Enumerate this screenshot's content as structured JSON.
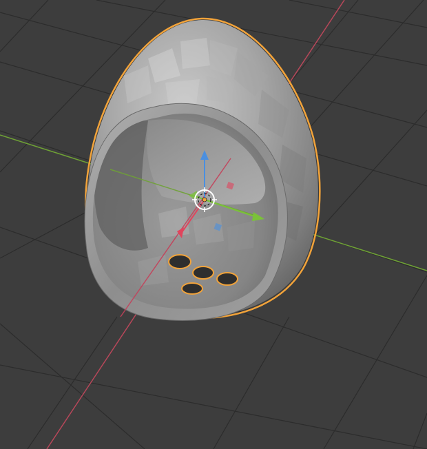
{
  "viewport": {
    "mode": "object",
    "background_color": "#3d3d3d",
    "grid_color": "#2b2b2b",
    "x_axis_color": "#d94b5c",
    "y_axis_color": "#7bb83a",
    "z_axis_color": "#4a8fe0",
    "selection_outline_color": "#f2a33a"
  },
  "object": {
    "name": "egg",
    "selected": true,
    "mesh_color": "#9c9c9c",
    "hole_count": 4
  },
  "gizmo": {
    "icons": [
      "transform-pivot-icon",
      "origin-dot-icon"
    ]
  }
}
